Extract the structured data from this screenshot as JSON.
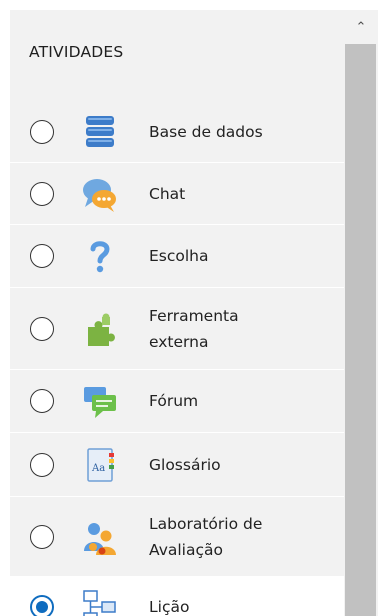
{
  "section": {
    "title": "ATIVIDADES"
  },
  "activities": [
    {
      "label": "Base de dados",
      "icon": "database-icon",
      "checked": false
    },
    {
      "label": "Chat",
      "icon": "chat-icon",
      "checked": false
    },
    {
      "label": "Escolha",
      "icon": "question-mark-icon",
      "checked": false
    },
    {
      "label_lines": [
        "Ferramenta",
        "externa"
      ],
      "icon": "puzzle-icon",
      "checked": false
    },
    {
      "label": "Fórum",
      "icon": "forum-icon",
      "checked": false
    },
    {
      "label": "Glossário",
      "icon": "glossary-icon",
      "checked": false
    },
    {
      "label_lines": [
        "Laboratório de",
        "Avaliação"
      ],
      "icon": "workshop-icon",
      "checked": false
    },
    {
      "label": "Lição",
      "icon": "lesson-icon",
      "checked": true
    }
  ],
  "scrollbar": {
    "up_arrow": "⌃"
  },
  "colors": {
    "accent": "#0f6cbf",
    "panel_bg": "#f2f2f2"
  }
}
